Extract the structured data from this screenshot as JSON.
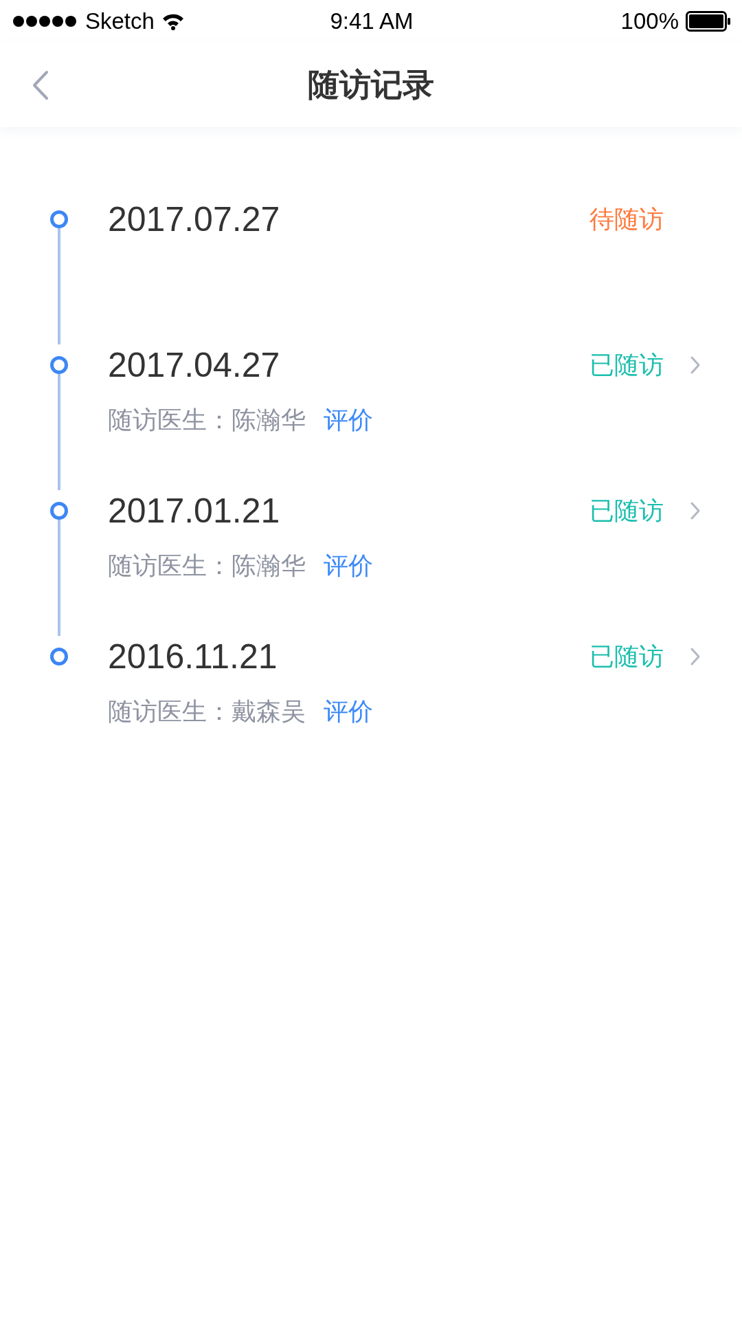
{
  "status_bar": {
    "carrier": "Sketch",
    "time": "9:41 AM",
    "battery": "100%"
  },
  "nav": {
    "title": "随访记录"
  },
  "records": [
    {
      "date": "2017.07.27",
      "status": "待随访",
      "kind": "pending"
    },
    {
      "date": "2017.04.27",
      "status": "已随访",
      "kind": "done",
      "doctor_label": "随访医生：",
      "doctor": "陈瀚华",
      "action": "评价"
    },
    {
      "date": "2017.01.21",
      "status": "已随访",
      "kind": "done",
      "doctor_label": "随访医生：",
      "doctor": "陈瀚华",
      "action": "评价"
    },
    {
      "date": "2016.11.21",
      "status": "已随访",
      "kind": "done",
      "doctor_label": "随访医生：",
      "doctor": "戴森吴",
      "action": "评价"
    }
  ]
}
